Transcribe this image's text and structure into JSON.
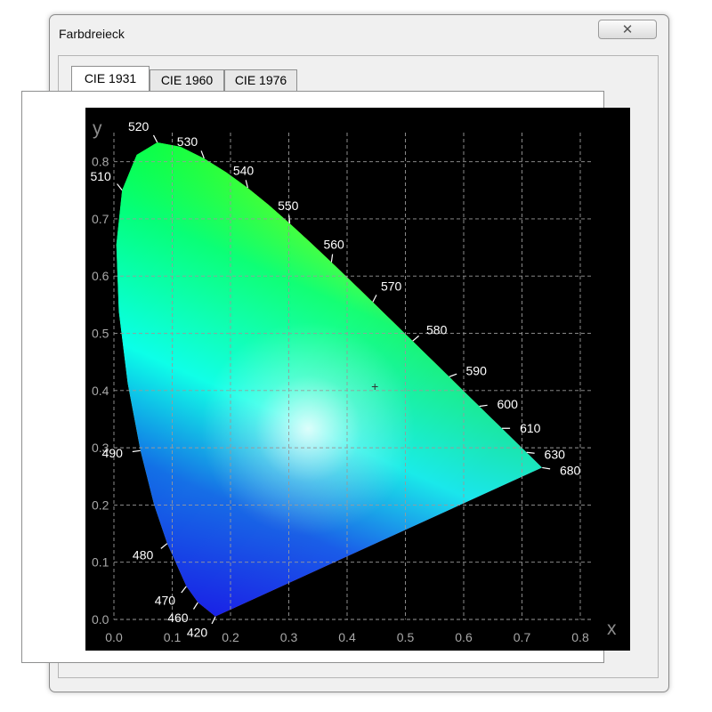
{
  "window": {
    "title": "Farbdreieck",
    "close_glyph": "✕"
  },
  "tabs": [
    {
      "label": "CIE 1931",
      "active": true
    },
    {
      "label": "CIE 1960",
      "active": false
    },
    {
      "label": "CIE 1976",
      "active": false
    }
  ],
  "chart_data": {
    "type": "scatter",
    "description_type": "chromaticity-diagram",
    "xlabel": "x",
    "ylabel": "y",
    "xlim": [
      0.0,
      0.8
    ],
    "ylim": [
      0.0,
      0.85
    ],
    "xticks": [
      "0.0",
      "0.1",
      "0.2",
      "0.3",
      "0.4",
      "0.5",
      "0.6",
      "0.7",
      "0.8"
    ],
    "yticks": [
      "0.0",
      "0.1",
      "0.2",
      "0.3",
      "0.4",
      "0.5",
      "0.6",
      "0.7",
      "0.8"
    ],
    "grid": true,
    "wavelength_labels": [
      {
        "label": "420",
        "x": 0.1741,
        "y": 0.005
      },
      {
        "label": "460",
        "x": 0.144,
        "y": 0.0297
      },
      {
        "label": "470",
        "x": 0.1241,
        "y": 0.0578
      },
      {
        "label": "480",
        "x": 0.0913,
        "y": 0.1327
      },
      {
        "label": "490",
        "x": 0.0454,
        "y": 0.295
      },
      {
        "label": "510",
        "x": 0.0139,
        "y": 0.7502
      },
      {
        "label": "520",
        "x": 0.0743,
        "y": 0.8338
      },
      {
        "label": "530",
        "x": 0.1547,
        "y": 0.8059
      },
      {
        "label": "540",
        "x": 0.2296,
        "y": 0.7543
      },
      {
        "label": "550",
        "x": 0.3016,
        "y": 0.6923
      },
      {
        "label": "560",
        "x": 0.3731,
        "y": 0.6245
      },
      {
        "label": "570",
        "x": 0.4441,
        "y": 0.5547
      },
      {
        "label": "580",
        "x": 0.5125,
        "y": 0.4866
      },
      {
        "label": "590",
        "x": 0.5752,
        "y": 0.4242
      },
      {
        "label": "600",
        "x": 0.627,
        "y": 0.3725
      },
      {
        "label": "610",
        "x": 0.6658,
        "y": 0.334
      },
      {
        "label": "630",
        "x": 0.7079,
        "y": 0.292
      },
      {
        "label": "680",
        "x": 0.7347,
        "y": 0.2653
      }
    ],
    "locus": [
      {
        "x": 0.1741,
        "y": 0.005
      },
      {
        "x": 0.144,
        "y": 0.0297
      },
      {
        "x": 0.1241,
        "y": 0.0578
      },
      {
        "x": 0.0913,
        "y": 0.1327
      },
      {
        "x": 0.0687,
        "y": 0.2007
      },
      {
        "x": 0.0454,
        "y": 0.295
      },
      {
        "x": 0.0235,
        "y": 0.4127
      },
      {
        "x": 0.0082,
        "y": 0.5384
      },
      {
        "x": 0.0039,
        "y": 0.6548
      },
      {
        "x": 0.0139,
        "y": 0.7502
      },
      {
        "x": 0.0389,
        "y": 0.812
      },
      {
        "x": 0.0743,
        "y": 0.8338
      },
      {
        "x": 0.1142,
        "y": 0.8262
      },
      {
        "x": 0.1547,
        "y": 0.8059
      },
      {
        "x": 0.1929,
        "y": 0.7816
      },
      {
        "x": 0.2296,
        "y": 0.7543
      },
      {
        "x": 0.2658,
        "y": 0.7243
      },
      {
        "x": 0.3016,
        "y": 0.6923
      },
      {
        "x": 0.3373,
        "y": 0.6589
      },
      {
        "x": 0.3731,
        "y": 0.6245
      },
      {
        "x": 0.4087,
        "y": 0.5896
      },
      {
        "x": 0.4441,
        "y": 0.5547
      },
      {
        "x": 0.4788,
        "y": 0.5202
      },
      {
        "x": 0.5125,
        "y": 0.4866
      },
      {
        "x": 0.5448,
        "y": 0.4544
      },
      {
        "x": 0.5752,
        "y": 0.4242
      },
      {
        "x": 0.6029,
        "y": 0.3965
      },
      {
        "x": 0.627,
        "y": 0.3725
      },
      {
        "x": 0.6482,
        "y": 0.3514
      },
      {
        "x": 0.6658,
        "y": 0.334
      },
      {
        "x": 0.7079,
        "y": 0.292
      },
      {
        "x": 0.7347,
        "y": 0.2653
      }
    ],
    "white_point_marker": {
      "label": "+",
      "x": 0.4476,
      "y": 0.4074
    },
    "colors": {
      "background": "#000000",
      "grid": "#9a9a9a",
      "tick_text": "#a8a8a8",
      "axis_letter": "#8c8c8c",
      "label_text": "#ffffff"
    }
  }
}
